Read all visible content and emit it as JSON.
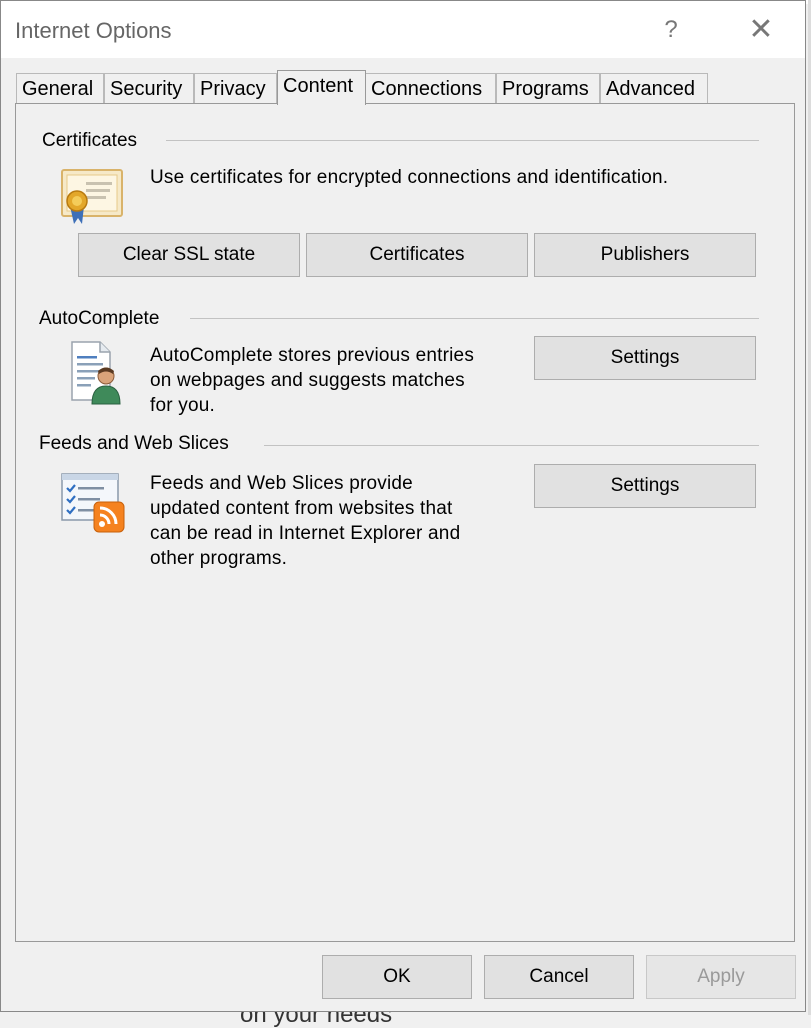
{
  "window": {
    "title": "Internet Options",
    "help_glyph": "?",
    "close_glyph": "✕"
  },
  "tabs": [
    {
      "label": "General"
    },
    {
      "label": "Security"
    },
    {
      "label": "Privacy"
    },
    {
      "label": "Content",
      "active": true
    },
    {
      "label": "Connections"
    },
    {
      "label": "Programs"
    },
    {
      "label": "Advanced"
    }
  ],
  "certificates": {
    "heading": "Certificates",
    "description": "Use certificates for encrypted connections and identification.",
    "icon": "certificate-icon",
    "buttons": {
      "clear_ssl": "Clear SSL state",
      "certificates": "Certificates",
      "publishers": "Publishers"
    }
  },
  "autocomplete": {
    "heading": "AutoComplete",
    "description_lines": [
      "AutoComplete stores previous entries",
      "on webpages and suggests matches",
      "for you."
    ],
    "icon": "autocomplete-document-user-icon",
    "settings_label": "Settings"
  },
  "feeds": {
    "heading": "Feeds and Web Slices",
    "description_lines": [
      "Feeds and Web Slices provide",
      "updated content from websites that",
      "can be read in Internet Explorer and",
      "other programs."
    ],
    "icon": "feeds-rss-icon",
    "settings_label": "Settings"
  },
  "footer": {
    "ok": "OK",
    "cancel": "Cancel",
    "apply": "Apply",
    "apply_disabled": true
  },
  "background_peek_text": "on your needs",
  "colors": {
    "dialog_bg": "#f0f0f0",
    "button_bg": "#e1e1e1",
    "button_border": "#adadad",
    "disabled_text": "#9a9a9a",
    "rss_orange": "#f5821f"
  }
}
